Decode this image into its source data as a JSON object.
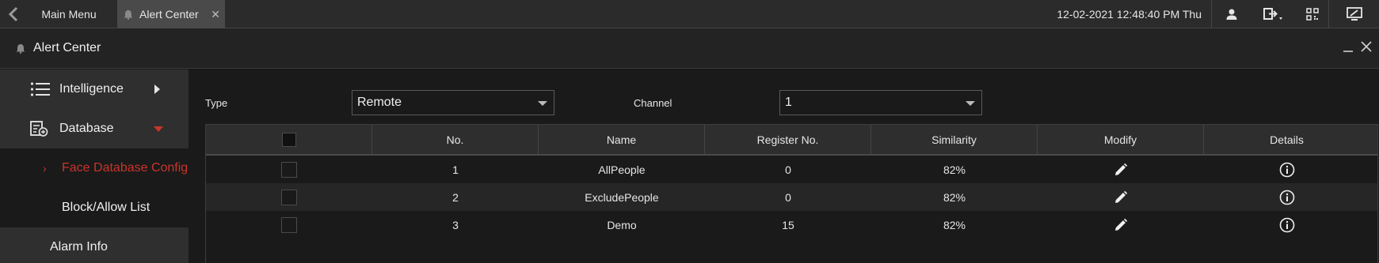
{
  "topbar": {
    "tabs": [
      {
        "label": "Main Menu"
      },
      {
        "label": "Alert Center"
      }
    ],
    "datetime": "12-02-2021 12:48:40 PM Thu"
  },
  "panel": {
    "title": "Alert Center"
  },
  "sidebar": {
    "items": [
      {
        "label": "Intelligence",
        "icon": "list-icon"
      },
      {
        "label": "Database",
        "icon": "database-icon"
      },
      {
        "label": "Face Database Config",
        "active": true
      },
      {
        "label": "Block/Allow List"
      },
      {
        "label": "Alarm Info"
      }
    ]
  },
  "filters": {
    "type_label": "Type",
    "type_value": "Remote",
    "channel_label": "Channel",
    "channel_value": "1"
  },
  "table": {
    "columns": [
      "No.",
      "Name",
      "Register No.",
      "Similarity",
      "Modify",
      "Details"
    ],
    "rows": [
      {
        "no": "1",
        "name": "AllPeople",
        "register": "0",
        "similarity": "82%"
      },
      {
        "no": "2",
        "name": "ExcludePeople",
        "register": "0",
        "similarity": "82%"
      },
      {
        "no": "3",
        "name": "Demo",
        "register": "15",
        "similarity": "82%"
      }
    ]
  },
  "colors": {
    "accent": "#c8352b",
    "background": "#1a1a1a",
    "header": "#2e2e2e"
  }
}
